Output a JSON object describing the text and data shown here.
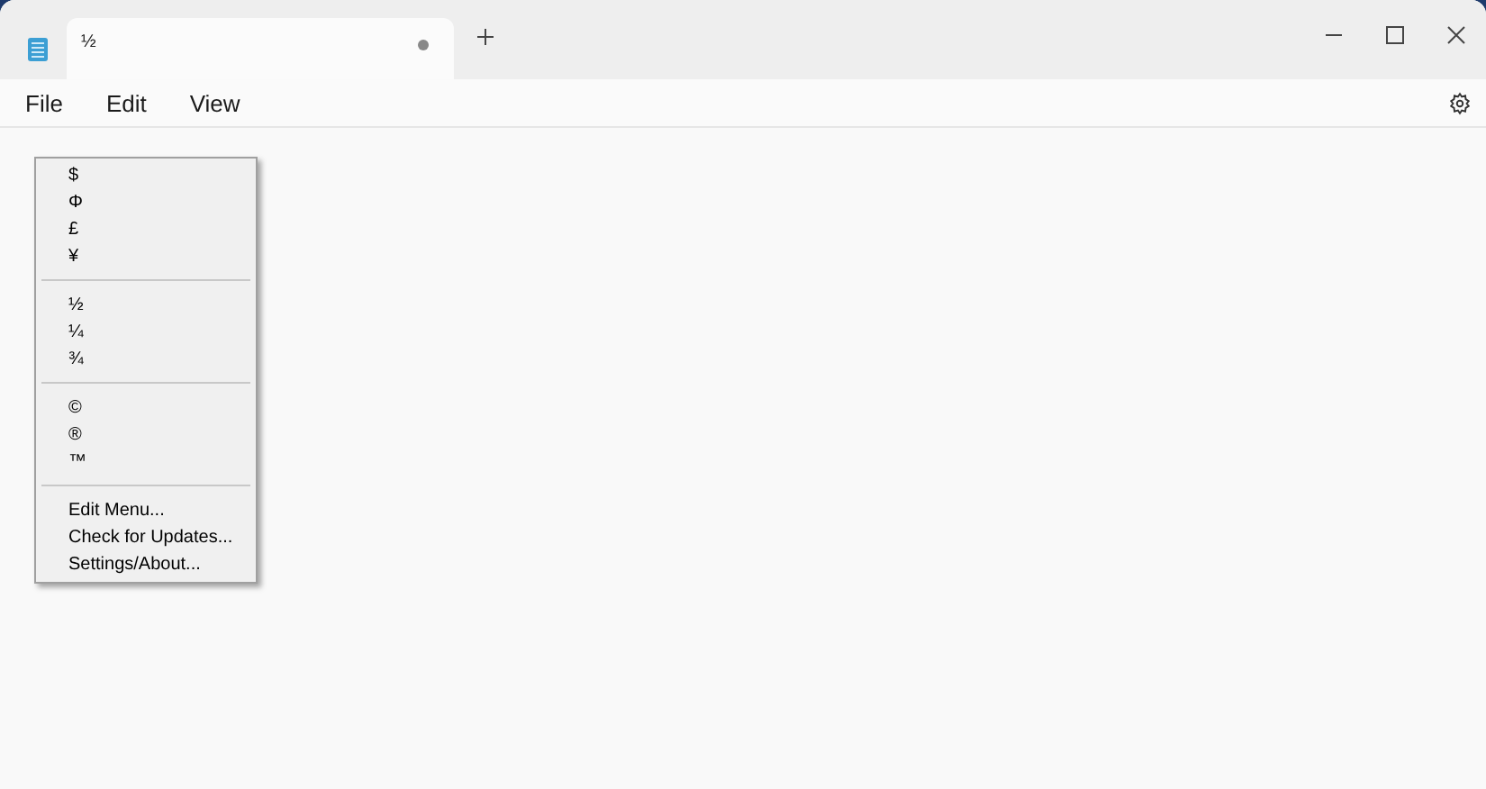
{
  "tab": {
    "title": "½",
    "modified": true
  },
  "menu_bar": [
    "File",
    "Edit",
    "View"
  ],
  "context_menu": {
    "groups": [
      [
        "$",
        "Φ",
        "£",
        "¥"
      ],
      [
        "½",
        "¼",
        "¾"
      ],
      [
        "©",
        "®",
        "™"
      ],
      [
        "Edit Menu...",
        "Check for Updates...",
        "Settings/About..."
      ]
    ]
  }
}
